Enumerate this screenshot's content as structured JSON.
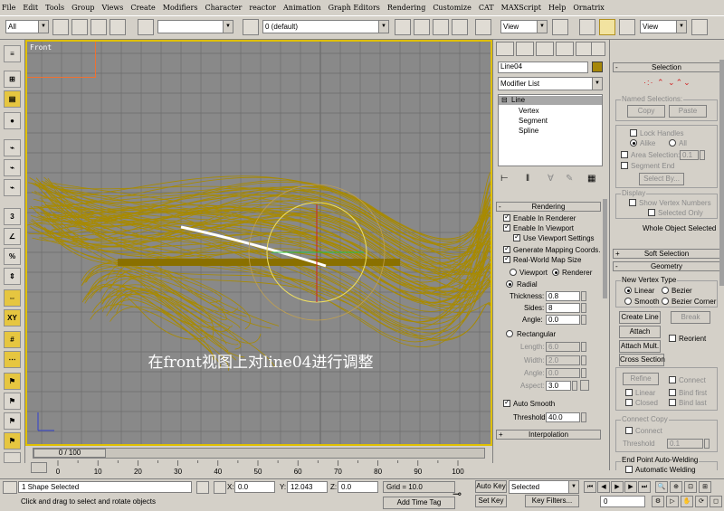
{
  "menubar": {
    "items": [
      "File",
      "Edit",
      "Tools",
      "Group",
      "Views",
      "Create",
      "Modifiers",
      "Character",
      "reactor",
      "Animation",
      "Graph Editors",
      "Rendering",
      "Customize",
      "CAT",
      "MAXScript",
      "Help",
      "Ornatrix"
    ]
  },
  "toolbar": {
    "selection_filter": "All",
    "named_set": "",
    "layer": "0 (default)",
    "ref_coord_1": "View",
    "ref_coord_2": "View"
  },
  "viewport": {
    "label": "Front",
    "caption": "在front视图上对line04进行调整",
    "wire_color": "#a88a00",
    "border_color": "#e0c000"
  },
  "command_panel": {
    "object_name": "Line04",
    "object_color": "#a6870a",
    "modifier_list": "Modifier List",
    "stack": [
      "Line",
      "Vertex",
      "Segment",
      "Spline"
    ],
    "rendering": {
      "title": "Rendering",
      "enable_in_renderer": "Enable In Renderer",
      "enable_in_viewport": "Enable In Viewport",
      "use_viewport_settings": "Use Viewport Settings",
      "generate_mapping": "Generate Mapping Coords.",
      "real_world_map": "Real-World Map Size",
      "viewport": "Viewport",
      "renderer": "Renderer",
      "radial": "Radial",
      "thickness_label": "Thickness:",
      "thickness": "0.8",
      "sides_label": "Sides:",
      "sides": "8",
      "angle_label": "Angle:",
      "angle": "0.0",
      "rectangular": "Rectangular",
      "length_label": "Length:",
      "length": "6.0",
      "width_label": "Width:",
      "width": "2.0",
      "angle2_label": "Angle:",
      "angle2": "0.0",
      "aspect_label": "Aspect:",
      "aspect": "3.0",
      "auto_smooth": "Auto Smooth",
      "threshold_label": "Threshold:",
      "threshold": "40.0"
    },
    "interpolation": "Interpolation"
  },
  "right_panel": {
    "selection": {
      "title": "Selection",
      "named_selections": "Named Selections:",
      "copy": "Copy",
      "paste": "Paste",
      "lock_handles": "Lock Handles",
      "alike": "Alike",
      "all": "All",
      "area_selection": "Area Selection:",
      "area_value": "0.1",
      "segment_end": "Segment End",
      "select_by": "Select By...",
      "display": "Display",
      "show_vertex_numbers": "Show Vertex Numbers",
      "selected_only": "Selected Only",
      "status": "Whole Object Selected"
    },
    "soft_selection": "Soft Selection",
    "geometry": {
      "title": "Geometry",
      "new_vertex_type": "New Vertex Type",
      "linear": "Linear",
      "bezier": "Bezier",
      "smooth": "Smooth",
      "bezier_corner": "Bezier Corner",
      "create_line": "Create Line",
      "break": "Break",
      "attach": "Attach",
      "reorient": "Reorient",
      "attach_mult": "Attach Mult.",
      "cross_section": "Cross Section",
      "refine": "Refine",
      "connect": "Connect",
      "linear2": "Linear",
      "bind_first": "Bind first",
      "closed": "Closed",
      "bind_last": "Bind last",
      "connect_copy": "Connect Copy",
      "connect2": "Connect",
      "threshold_label": "Threshold",
      "threshold": "0.1",
      "end_point": "End Point Auto-Welding",
      "auto_weld": "Automatic Welding"
    }
  },
  "timeline": {
    "frame": "0 / 100",
    "ticks": [
      "0",
      "10",
      "20",
      "30",
      "40",
      "50",
      "60",
      "70",
      "80",
      "90",
      "100"
    ]
  },
  "status": {
    "shape_selected": "1 Shape Selected",
    "prompt": "Click and drag to select and rotate objects",
    "x_label": "X:",
    "x": "0.0",
    "y_label": "Y:",
    "y": "12.043",
    "z_label": "Z:",
    "z": "0.0",
    "grid": "Grid = 10.0",
    "add_time_tag": "Add Time Tag",
    "auto_key": "Auto Key",
    "selected": "Selected",
    "set_key": "Set Key",
    "key_filters": "Key Filters...",
    "frame": "0"
  }
}
